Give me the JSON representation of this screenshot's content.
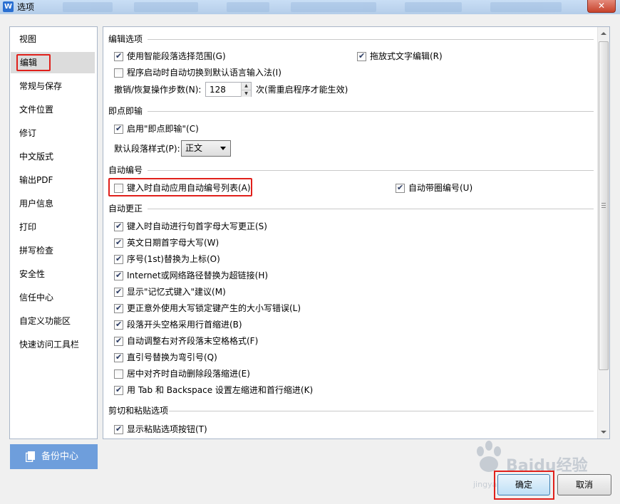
{
  "window": {
    "title": "选项",
    "app_icon_letter": "W",
    "close_glyph": "✕"
  },
  "sidebar": {
    "items": [
      {
        "label": "视图"
      },
      {
        "label": "编辑"
      },
      {
        "label": "常规与保存"
      },
      {
        "label": "文件位置"
      },
      {
        "label": "修订"
      },
      {
        "label": "中文版式"
      },
      {
        "label": "输出PDF"
      },
      {
        "label": "用户信息"
      },
      {
        "label": "打印"
      },
      {
        "label": "拼写检查"
      },
      {
        "label": "安全性"
      },
      {
        "label": "信任中心"
      },
      {
        "label": "自定义功能区"
      },
      {
        "label": "快速访问工具栏"
      }
    ],
    "selected_index": 1
  },
  "backup_button": {
    "label": "备份中心",
    "icon": "backup-icon"
  },
  "sections": {
    "edit_options": {
      "title": "编辑选项",
      "smart_select": {
        "label": "使用智能段落选择范围(G)",
        "checked": true
      },
      "drag_edit": {
        "label": "拖放式文字编辑(R)",
        "checked": true
      },
      "auto_ime": {
        "label": "程序启动时自动切换到默认语言输入法(I)",
        "checked": false
      },
      "undo_label": "撤销/恢复操作步数(N):",
      "undo_value": "128",
      "undo_note": "次(需重启程序才能生效)"
    },
    "click_type": {
      "title": "即点即输",
      "enable": {
        "label": "启用\"即点即输\"(C)",
        "checked": true
      },
      "para_style_label": "默认段落样式(P):",
      "para_style_value": "正文"
    },
    "auto_numbering": {
      "title": "自动编号",
      "auto_list": {
        "label": "键入时自动应用自动编号列表(A)",
        "checked": false
      },
      "circled": {
        "label": "自动带圈编号(U)",
        "checked": true
      }
    },
    "auto_correct": {
      "title": "自动更正",
      "items": [
        {
          "label": "键入时自动进行句首字母大写更正(S)",
          "checked": true
        },
        {
          "label": "英文日期首字母大写(W)",
          "checked": true
        },
        {
          "label": "序号(1st)替换为上标(O)",
          "checked": true
        },
        {
          "label": "Internet或网络路径替换为超链接(H)",
          "checked": true
        },
        {
          "label": "显示\"记忆式键入\"建议(M)",
          "checked": true
        },
        {
          "label": "更正意外使用大写锁定键产生的大小写错误(L)",
          "checked": true
        },
        {
          "label": "段落开头空格采用行首缩进(B)",
          "checked": true
        },
        {
          "label": "自动调整右对齐段落末空格格式(F)",
          "checked": true
        },
        {
          "label": "直引号替换为弯引号(Q)",
          "checked": true
        },
        {
          "label": "居中对齐时自动删除段落缩进(E)",
          "checked": false
        },
        {
          "label": "用 Tab 和 Backspace 设置左缩进和首行缩进(K)",
          "checked": true
        }
      ]
    },
    "cut_paste": {
      "title": "剪切和粘贴选项",
      "show_paste_button": {
        "label": "显示粘贴选项按钮(T)",
        "checked": true
      }
    }
  },
  "buttons": {
    "ok": "确定",
    "cancel": "取消"
  },
  "watermark": {
    "brand": "Baidu经验",
    "sub": "jingyan.baidu.com"
  },
  "colors": {
    "highlight": "#e0201b",
    "backup_button": "#6e9edc",
    "title_bar": "#c9def5"
  }
}
